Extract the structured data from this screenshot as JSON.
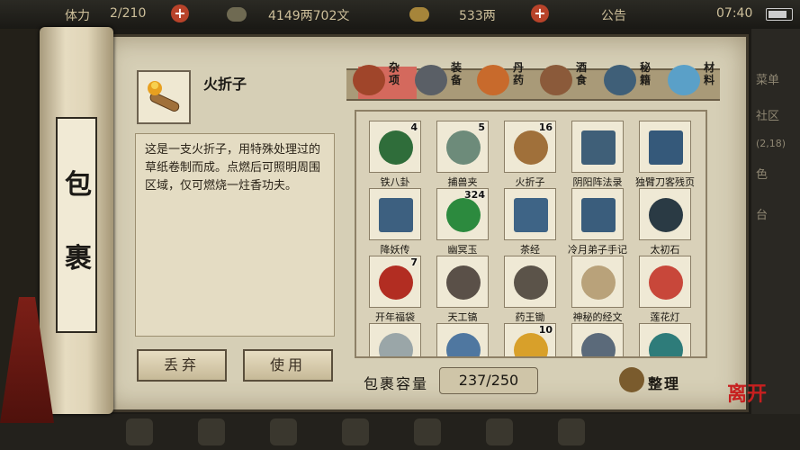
{
  "topbar": {
    "energy": "2/210",
    "silver": "4149两702文",
    "gold": "533两",
    "announcement": "公告",
    "time": "07:40"
  },
  "side_menu": [
    "菜单",
    "社区",
    "(2,18)",
    "色",
    "台"
  ],
  "scroll_title": [
    "包",
    "裹"
  ],
  "selected_item": {
    "name": "火折子",
    "description": "这是一支火折子，用特殊处理过的草纸卷制而成。点燃后可照明周围区域，仅可燃烧一炷香功夫。"
  },
  "buttons": {
    "discard": "丢弃",
    "use": "使用",
    "sort": "整理"
  },
  "tabs": [
    {
      "label": "杂项",
      "icon": "jar-icon",
      "active": true
    },
    {
      "label": "装备",
      "icon": "weapon-icon",
      "active": false
    },
    {
      "label": "丹药",
      "icon": "pill-icon",
      "active": false
    },
    {
      "label": "酒食",
      "icon": "food-icon",
      "active": false
    },
    {
      "label": "秘籍",
      "icon": "book-icon",
      "active": false
    },
    {
      "label": "材料",
      "icon": "crystal-icon",
      "active": false
    }
  ],
  "items": [
    {
      "name": "铁八卦",
      "count": "4",
      "icon": "bagua-icon",
      "color": "#2f6d3a"
    },
    {
      "name": "捕兽夹",
      "count": "5",
      "icon": "trap-icon",
      "color": "#6d8b7a"
    },
    {
      "name": "火折子",
      "count": "16",
      "icon": "torch-icon",
      "color": "#a0703a"
    },
    {
      "name": "阴阳阵法录",
      "count": "",
      "icon": "book-icon",
      "color": "#3f5f78"
    },
    {
      "name": "独臂刀客残页",
      "count": "",
      "icon": "book-icon",
      "color": "#35597a"
    },
    {
      "name": "降妖传",
      "count": "",
      "icon": "book-icon",
      "color": "#3d6080"
    },
    {
      "name": "幽冥玉",
      "count": "324",
      "icon": "jade-icon",
      "color": "#2c8a3e"
    },
    {
      "name": "茶经",
      "count": "",
      "icon": "book-icon",
      "color": "#3e6486"
    },
    {
      "name": "冷月弟子手记",
      "count": "",
      "icon": "book-icon",
      "color": "#3a5d7c"
    },
    {
      "name": "太初石",
      "count": "",
      "icon": "stone-icon",
      "color": "#2a3a44"
    },
    {
      "name": "开年福袋",
      "count": "7",
      "icon": "pouch-icon",
      "color": "#b22d22"
    },
    {
      "name": "天工镐",
      "count": "",
      "icon": "pickaxe-icon",
      "color": "#5a5048"
    },
    {
      "name": "药王锄",
      "count": "",
      "icon": "hoe-icon",
      "color": "#5b5349"
    },
    {
      "name": "神秘的经文",
      "count": "",
      "icon": "scroll-icon",
      "color": "#b9a27a"
    },
    {
      "name": "莲花灯",
      "count": "",
      "icon": "lotus-icon",
      "color": "#c8473a"
    },
    {
      "name": "",
      "count": "",
      "icon": "mirror-icon",
      "color": "#9aa6a8"
    },
    {
      "name": "",
      "count": "",
      "icon": "ore-icon",
      "color": "#4f77a0"
    },
    {
      "name": "",
      "count": "10",
      "icon": "potion-icon",
      "color": "#d8a02a"
    },
    {
      "name": "",
      "count": "",
      "icon": "key-icon",
      "color": "#5b6a7a"
    },
    {
      "name": "",
      "count": "",
      "icon": "dragon-icon",
      "color": "#2e7c7a"
    }
  ],
  "capacity": {
    "label": "包裹容量",
    "value": "237/250"
  },
  "logo_text": "离开"
}
